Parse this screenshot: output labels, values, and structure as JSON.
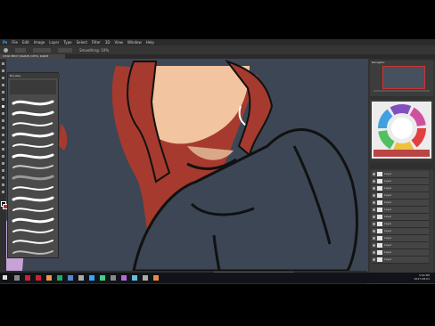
{
  "menu": [
    "File",
    "Edit",
    "Image",
    "Layer",
    "Type",
    "Select",
    "Filter",
    "3D",
    "View",
    "Window",
    "Help"
  ],
  "document_tab": "CHAR BECH (RGB/8) CMYK, RGB/8",
  "brush_panel_title": "Brushes",
  "options": [
    "Smoothing: 10%"
  ],
  "navigator_title": "Navigator",
  "layers": [
    "Layer",
    "Layer",
    "Layer",
    "Layer",
    "Layer",
    "Layer",
    "Layer",
    "Layer",
    "Layer",
    "Layer",
    "Layer",
    "Layer",
    "Layer"
  ],
  "status_zoom": "33.33%",
  "clock": {
    "time": "3:04 PM",
    "date": "2017-08-01"
  },
  "colors": {
    "background": "#3d4654",
    "hair": "#a63a2e",
    "skin": "#f2c4a0",
    "shirt": "#3c4654",
    "line": "#111111"
  }
}
